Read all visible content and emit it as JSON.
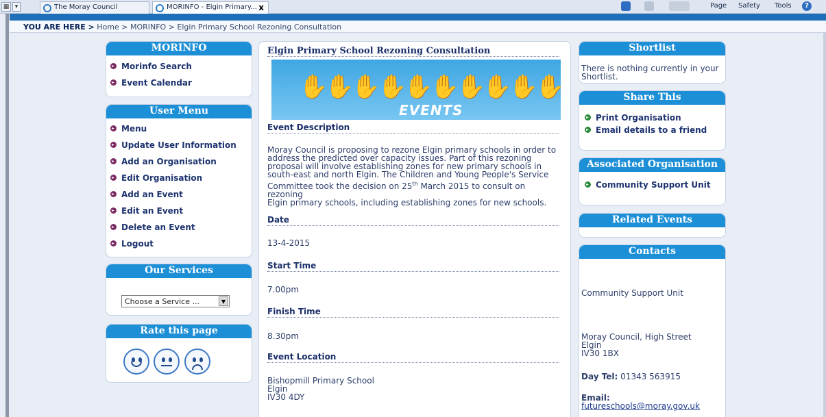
{
  "browser": {
    "tabs": [
      {
        "title": "The Moray Council"
      },
      {
        "title": "MORINFO - Elgin Primary..."
      }
    ],
    "commands": [
      "Page",
      "Safety",
      "Tools"
    ]
  },
  "breadcrumb": {
    "prefix": "YOU ARE HERE >",
    "path": "Home > MORINFO > Elgin Primary School Rezoning Consultation"
  },
  "morinfo": {
    "title": "MORINFO",
    "items": [
      "Morinfo Search",
      "Event Calendar"
    ]
  },
  "user_menu": {
    "title": "User Menu",
    "items": [
      "Menu",
      "Update User Information",
      "Add an Organisation",
      "Edit Organisation",
      "Add an Event",
      "Edit an Event",
      "Delete an Event",
      "Logout"
    ]
  },
  "services": {
    "title": "Our Services",
    "select_value": "Choose a Service ..."
  },
  "rate": {
    "title": "Rate this page"
  },
  "main": {
    "title": "Elgin Primary School Rezoning Consultation",
    "banner_text": "EVENTS",
    "description_heading": "Event Description",
    "description_lines": [
      "Moray Council is proposing to rezone Elgin primary schools in order to",
      "address the predicted over capacity issues.  Part of this rezoning",
      "proposal will involve establishing zones for new primary schools in",
      "south-east and north Elgin.  The Children and Young People's Service"
    ],
    "description_line5_a": "Committee took the decision on 25",
    "description_line5_sup": "th",
    "description_line5_b": " March 2015 to consult on rezoning",
    "description_line6": "Elgin primary schools, including establishing zones for new schools.",
    "date_heading": "Date",
    "date": "13-4-2015",
    "start_heading": "Start Time",
    "start": "7.00pm",
    "finish_heading": "Finish Time",
    "finish": "8.30pm",
    "location_heading": "Event Location",
    "location": [
      "Bishopmill Primary School",
      "Elgin",
      "IV30 4DY"
    ]
  },
  "shortlist": {
    "title": "Shortlist",
    "text": [
      "There is nothing currently in your",
      "Shortlist."
    ]
  },
  "share": {
    "title": "Share This",
    "items": [
      "Print Organisation",
      "Email details to a friend"
    ]
  },
  "associated": {
    "title": "Associated Organisation",
    "items": [
      "Community Support Unit"
    ]
  },
  "related": {
    "title": "Related Events"
  },
  "contacts": {
    "title": "Contacts",
    "org": "Community Support Unit",
    "address": [
      "Moray Council, High Street",
      "Elgin",
      "IV30 1BX"
    ],
    "tel_label": "Day Tel:",
    "tel": "01343 563915",
    "email_label": "Email:",
    "email": "futureschools@moray.gov.uk"
  },
  "colors": {
    "header_blue": "#1d8fd6",
    "top_bar_blue": "#1e6fb8",
    "bullet_purple": "#7a2a63",
    "bullet_green": "#2a8a3a"
  }
}
